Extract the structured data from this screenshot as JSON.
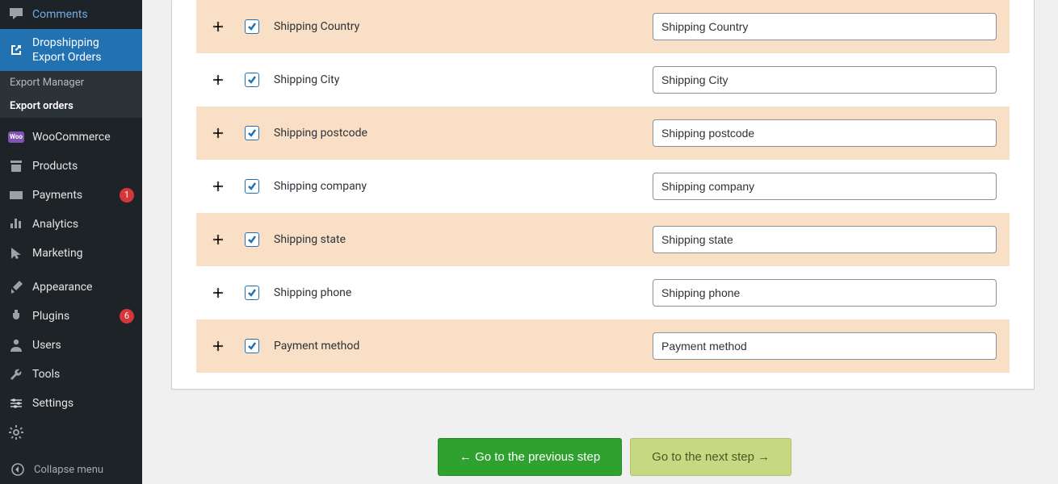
{
  "sidebar": {
    "comments": "Comments",
    "dropship": "Dropshipping Export Orders",
    "submenu": {
      "export_manager": "Export Manager",
      "export_orders": "Export orders"
    },
    "woocommerce": "WooCommerce",
    "products": "Products",
    "payments": "Payments",
    "payments_badge": "1",
    "analytics": "Analytics",
    "marketing": "Marketing",
    "appearance": "Appearance",
    "plugins": "Plugins",
    "plugins_badge": "6",
    "users": "Users",
    "tools": "Tools",
    "settings": "Settings",
    "collapse": "Collapse menu",
    "woo_badge": "Woo"
  },
  "fields": [
    {
      "label": "Shipping Country",
      "value": "Shipping Country"
    },
    {
      "label": "Shipping City",
      "value": "Shipping City"
    },
    {
      "label": "Shipping postcode",
      "value": "Shipping postcode"
    },
    {
      "label": "Shipping company",
      "value": "Shipping company"
    },
    {
      "label": "Shipping state",
      "value": "Shipping state"
    },
    {
      "label": "Shipping phone",
      "value": "Shipping phone"
    },
    {
      "label": "Payment method",
      "value": "Payment method"
    }
  ],
  "buttons": {
    "prev": "← Go to the previous step",
    "next": "Go to the next step →"
  }
}
